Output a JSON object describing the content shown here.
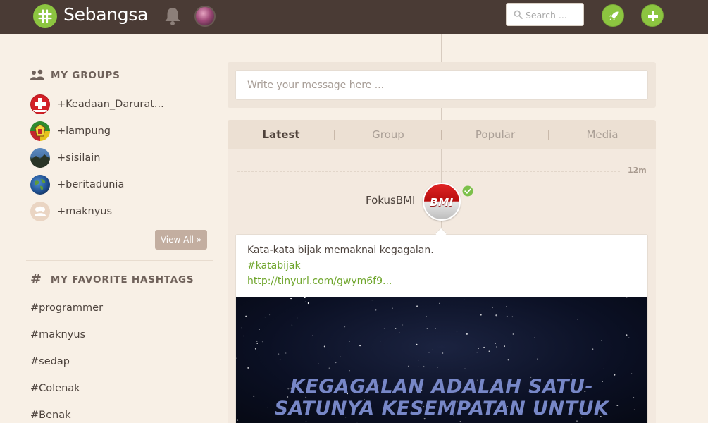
{
  "header": {
    "brand": "Sebangsa",
    "search_placeholder": "Search ...",
    "colors": {
      "bar": "#4a3b35",
      "accent": "#8cc540"
    }
  },
  "sidebar": {
    "groups_title": "MY GROUPS",
    "groups": [
      {
        "label": "+Keadaan_Darurat...",
        "icon": "emergency-cross"
      },
      {
        "label": "+lampung",
        "icon": "lampung-emblem"
      },
      {
        "label": "+sisilain",
        "icon": "landscape"
      },
      {
        "label": "+beritadunia",
        "icon": "globe"
      },
      {
        "label": "+maknyus",
        "icon": "people-placeholder"
      }
    ],
    "view_all": "View All »",
    "hashtags_title": "MY FAVORITE HASHTAGS",
    "hashtags": [
      "#programmer",
      "#maknyus",
      "#sedap",
      "#Colenak",
      "#Benak"
    ]
  },
  "composer": {
    "placeholder": "Write your message here ..."
  },
  "tabs": [
    {
      "label": "Latest",
      "active": true
    },
    {
      "label": "Group",
      "active": false
    },
    {
      "label": "Popular",
      "active": false
    },
    {
      "label": "Media",
      "active": false
    }
  ],
  "post": {
    "time": "12m",
    "author": "FokusBMI",
    "avatar_text": "BMI",
    "text": "Kata-kata bijak memaknai kegagalan.",
    "hashtag": "#katabijak",
    "link": "http://tinyurl.com/gwym6f9...",
    "image_lines": [
      "KEGAGALAN ADALAH SATU-",
      "SATUNYA KESEMPATAN UNTUK"
    ]
  }
}
